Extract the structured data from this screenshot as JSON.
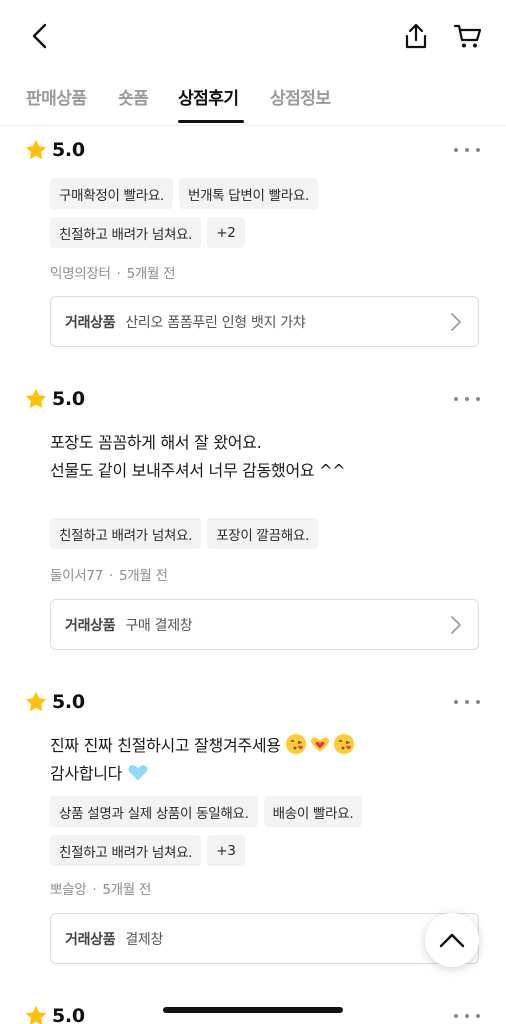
{
  "header": {
    "back_icon": "chevron-left-icon",
    "share_icon": "share-upload-icon",
    "cart_icon": "cart-icon"
  },
  "tabs": [
    {
      "label": "판매상품",
      "active": false
    },
    {
      "label": "숏폼",
      "active": false
    },
    {
      "label": "상점후기",
      "active": true
    },
    {
      "label": "상점정보",
      "active": false
    }
  ],
  "reviews": [
    {
      "score": "5.0",
      "text_lines": [],
      "chips": [
        [
          "구매확정이 빨라요.",
          "번개톡 답변이 빨라요."
        ],
        [
          "친절하고 배려가 넘쳐요.",
          "+2"
        ]
      ],
      "author": "익명의장터",
      "time": "5개월 전",
      "product_label": "거래상품",
      "product_name": "산리오 폼폼푸린 인형 뱃지 가챠"
    },
    {
      "score": "5.0",
      "text_lines": [
        "포장도 꼼꼼하게 해서 잘 왔어요.",
        "선물도 같이 보내주셔서 너무 감동했어요 ^^"
      ],
      "chips": [
        [
          "친절하고 배려가 넘쳐요.",
          "포장이 깔끔해요."
        ]
      ],
      "author": "둘이서77",
      "time": "5개월 전",
      "product_label": "거래상품",
      "product_name": "구매 결제창"
    },
    {
      "score": "5.0",
      "text_lines": [
        "진짜 진짜 친절하시고 잘챙겨주세용",
        "감사합니다"
      ],
      "chips": [
        [
          "상품 설명과 실제 상품이 동일해요.",
          "배송이 빨라요."
        ],
        [
          "친절하고 배려가 넘쳐요.",
          "+3"
        ]
      ],
      "author": "뽀슬앙",
      "time": "5개월 전",
      "product_label": "거래상품",
      "product_name": "결제창"
    },
    {
      "score": "5.0"
    }
  ],
  "colors": {
    "star": "#FFC107",
    "chip_bg": "#F3F3F3",
    "text_muted": "#8C8C8C",
    "heart_blue": "#8ED8F8"
  }
}
